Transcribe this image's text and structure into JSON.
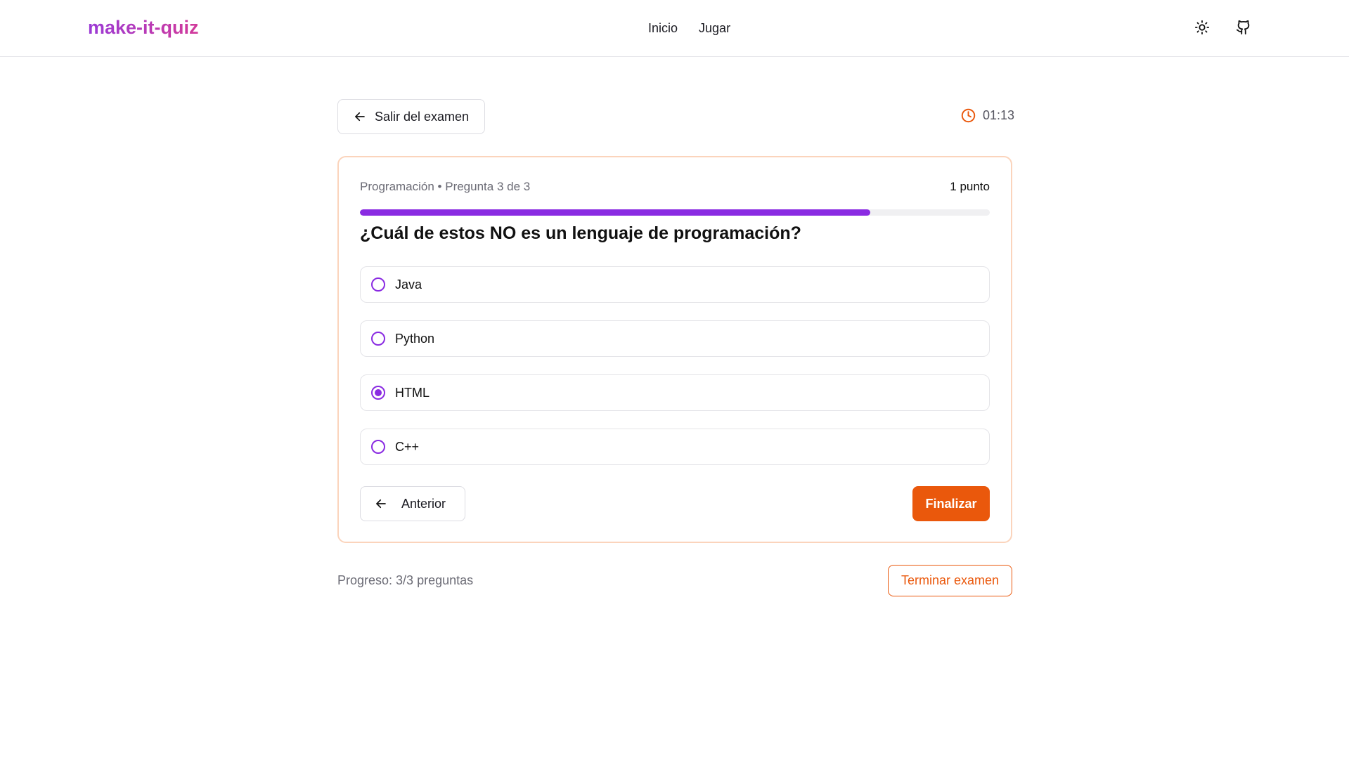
{
  "header": {
    "logo": "make-it-quiz",
    "nav": [
      "Inicio",
      "Jugar"
    ],
    "icons": [
      "sun-icon",
      "github-icon"
    ]
  },
  "top": {
    "exit_label": "Salir del examen",
    "timer": "01:13"
  },
  "quiz": {
    "meta": "Programación • Pregunta 3 de 3",
    "points": "1 punto",
    "progress_fraction": 0.81,
    "question": "¿Cuál de estos NO es un lenguaje de programación?",
    "options": [
      {
        "label": "Java",
        "selected": false
      },
      {
        "label": "Python",
        "selected": false
      },
      {
        "label": "HTML",
        "selected": true
      },
      {
        "label": "C++",
        "selected": false
      }
    ],
    "prev_label": "Anterior",
    "finish_label": "Finalizar"
  },
  "footer": {
    "progress": "Progreso: 3/3 preguntas",
    "end_label": "Terminar examen"
  },
  "colors": {
    "accent": "#8a2be2",
    "orange": "#ea580c",
    "card_border": "#fbd4bc"
  }
}
